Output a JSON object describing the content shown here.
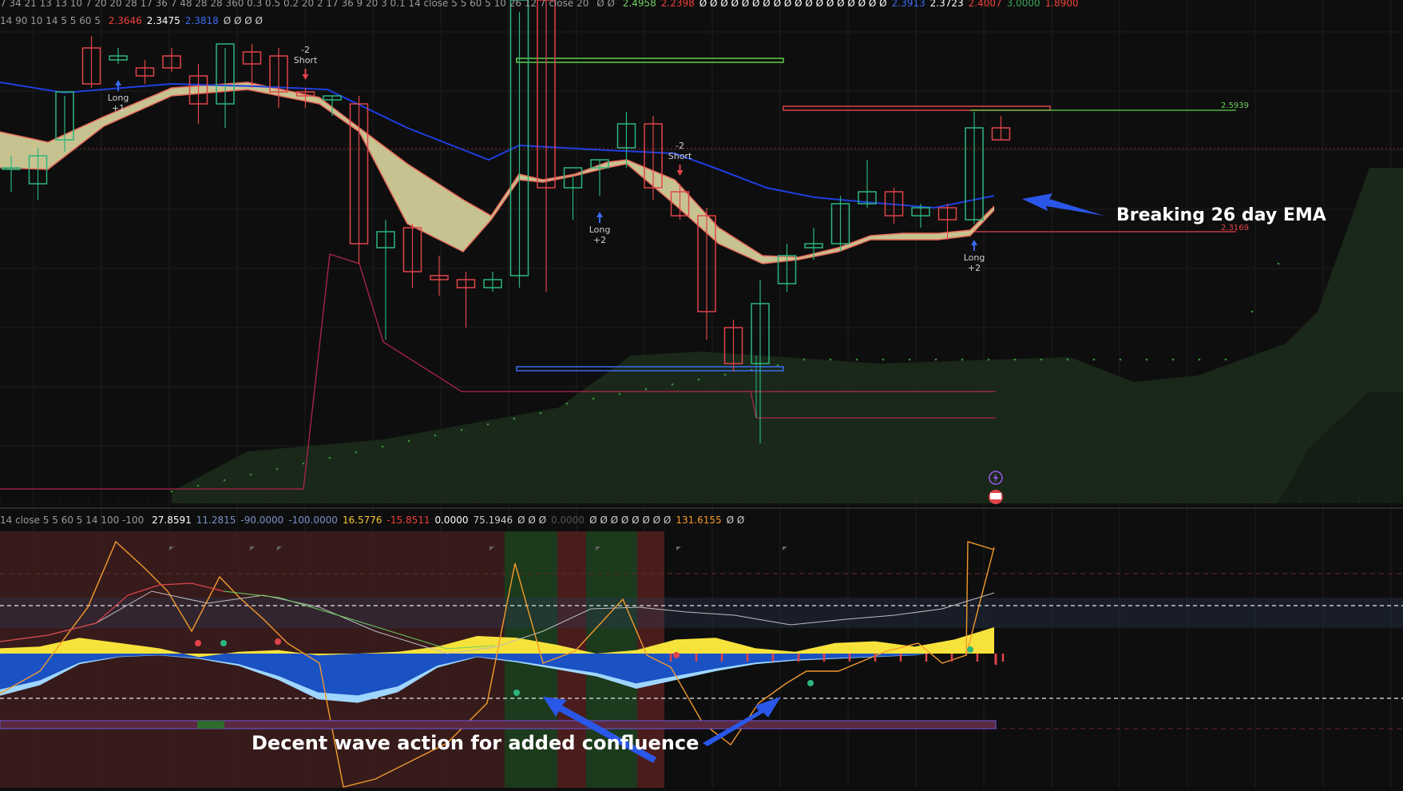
{
  "top_legend": {
    "row1": "7 34 21 13 13 10 7 20 20 28 17 36 7 48 28 28 360 0.3 0.5 0.2 20 2 17 36 9 20 3 0.1 14 close 5 5 60 5 10 26 12 7 close 20",
    "row1_symbols": "Ø Ø",
    "row1_values": [
      {
        "text": "2.4958",
        "color": "#6fcf63"
      },
      {
        "text": "2.2398",
        "color": "#f0413b"
      },
      {
        "text": "Ø Ø Ø Ø Ø Ø Ø Ø Ø Ø Ø Ø Ø Ø Ø Ø Ø Ø",
        "color": "#ffffff"
      },
      {
        "text": "2.3913",
        "color": "#3a6cf0"
      },
      {
        "text": "2.3723",
        "color": "#ffffff"
      },
      {
        "text": "2.4007",
        "color": "#f0413b"
      },
      {
        "text": "3.0000",
        "color": "#3aa55b"
      },
      {
        "text": "1.8900",
        "color": "#f0413b"
      }
    ],
    "row2_prefix": "14 90 10 14 5 5 60 5",
    "row2_values": [
      {
        "text": "2.3646",
        "color": "#f0413b"
      },
      {
        "text": "2.3475",
        "color": "#ffffff"
      },
      {
        "text": "2.3818",
        "color": "#3a6cf0"
      },
      {
        "text": "Ø Ø Ø Ø",
        "color": "#cfcfcf"
      }
    ]
  },
  "lower_legend": {
    "prefix": "14 close 5 5 60 5 14 100 -100",
    "values": [
      {
        "text": "27.8591",
        "color": "#ffffff"
      },
      {
        "text": "11.2815",
        "color": "#7a91c8"
      },
      {
        "text": "-90.0000",
        "color": "#7a91c8"
      },
      {
        "text": "-100.0000",
        "color": "#7a91c8"
      },
      {
        "text": "16.5776",
        "color": "#f6c531"
      },
      {
        "text": "-15.8511",
        "color": "#f0413b"
      },
      {
        "text": "0.0000",
        "color": "#ffffff"
      },
      {
        "text": "75.1946",
        "color": "#cfcfcf"
      },
      {
        "text": "Ø Ø Ø",
        "color": "#cfcfcf"
      },
      {
        "text": "0.0000",
        "color": "#555555"
      },
      {
        "text": "Ø Ø Ø Ø Ø Ø Ø Ø",
        "color": "#cfcfcf"
      },
      {
        "text": "131.6155",
        "color": "#f39a2c"
      },
      {
        "text": "Ø Ø",
        "color": "#cfcfcf"
      }
    ]
  },
  "annotations": {
    "breaking": "Breaking 26 day EMA",
    "wave": "Decent wave action for added confluence"
  },
  "colors": {
    "background": "#0e0e0e",
    "bull": "#2bb57d",
    "bear": "#e0444a",
    "ema": "#1f3fe0",
    "ribbon": "#e7e3a8",
    "cloud": "#1b2b1b",
    "wave_dark": "#1a52c4",
    "wave_light": "#9fd6ff",
    "money_flow": "#f7e23b",
    "arrow": "#2a57e8"
  },
  "chart_data": [
    {
      "type": "candlestick",
      "title": "",
      "price_range": [
        1.7,
        2.8
      ],
      "candles": [
        {
          "o": 2.46,
          "h": 2.49,
          "l": 2.4,
          "c": 2.46
        },
        {
          "o": 2.42,
          "h": 2.51,
          "l": 2.38,
          "c": 2.49
        },
        {
          "o": 2.53,
          "h": 2.64,
          "l": 2.5,
          "c": 2.65
        },
        {
          "o": 2.76,
          "h": 2.79,
          "l": 2.66,
          "c": 2.67
        },
        {
          "o": 2.73,
          "h": 2.76,
          "l": 2.72,
          "c": 2.74
        },
        {
          "o": 2.71,
          "h": 2.73,
          "l": 2.67,
          "c": 2.69
        },
        {
          "o": 2.74,
          "h": 2.76,
          "l": 2.7,
          "c": 2.71
        },
        {
          "o": 2.69,
          "h": 2.72,
          "l": 2.57,
          "c": 2.62
        },
        {
          "o": 2.62,
          "h": 2.76,
          "l": 2.56,
          "c": 2.77
        },
        {
          "o": 2.75,
          "h": 2.77,
          "l": 2.66,
          "c": 2.72
        },
        {
          "o": 2.74,
          "h": 2.76,
          "l": 2.61,
          "c": 2.65
        },
        {
          "o": 2.65,
          "h": 2.66,
          "l": 2.61,
          "c": 2.64
        },
        {
          "o": 2.63,
          "h": 2.64,
          "l": 2.59,
          "c": 2.64
        },
        {
          "o": 2.62,
          "h": 2.64,
          "l": 2.22,
          "c": 2.27
        },
        {
          "o": 2.26,
          "h": 2.33,
          "l": 2.03,
          "c": 2.3
        },
        {
          "o": 2.31,
          "h": 2.32,
          "l": 2.16,
          "c": 2.2
        },
        {
          "o": 2.19,
          "h": 2.24,
          "l": 2.14,
          "c": 2.18
        },
        {
          "o": 2.18,
          "h": 2.2,
          "l": 2.06,
          "c": 2.16
        },
        {
          "o": 2.16,
          "h": 2.2,
          "l": 2.15,
          "c": 2.18
        },
        {
          "o": 2.19,
          "h": 2.85,
          "l": 2.16,
          "c": 3.0
        },
        {
          "o": 2.98,
          "h": 3.0,
          "l": 2.15,
          "c": 2.41
        },
        {
          "o": 2.41,
          "h": 2.44,
          "l": 2.33,
          "c": 2.46
        },
        {
          "o": 2.46,
          "h": 2.48,
          "l": 2.39,
          "c": 2.48
        },
        {
          "o": 2.51,
          "h": 2.6,
          "l": 2.46,
          "c": 2.57
        },
        {
          "o": 2.57,
          "h": 2.59,
          "l": 2.38,
          "c": 2.41
        },
        {
          "o": 2.4,
          "h": 2.42,
          "l": 2.33,
          "c": 2.34
        },
        {
          "o": 2.34,
          "h": 2.36,
          "l": 2.03,
          "c": 2.1
        },
        {
          "o": 2.06,
          "h": 2.08,
          "l": 1.95,
          "c": 1.97
        },
        {
          "o": 1.97,
          "h": 2.18,
          "l": 1.77,
          "c": 2.12
        },
        {
          "o": 2.17,
          "h": 2.27,
          "l": 2.15,
          "c": 2.24
        },
        {
          "o": 2.26,
          "h": 2.31,
          "l": 2.23,
          "c": 2.27
        },
        {
          "o": 2.27,
          "h": 2.39,
          "l": 2.25,
          "c": 2.37
        },
        {
          "o": 2.37,
          "h": 2.48,
          "l": 2.36,
          "c": 2.4
        },
        {
          "o": 2.4,
          "h": 2.41,
          "l": 2.32,
          "c": 2.34
        },
        {
          "o": 2.34,
          "h": 2.37,
          "l": 2.31,
          "c": 2.36
        },
        {
          "o": 2.36,
          "h": 2.37,
          "l": 2.28,
          "c": 2.33
        },
        {
          "o": 2.33,
          "h": 2.6,
          "l": 2.32,
          "c": 2.56
        },
        {
          "o": 2.56,
          "h": 2.59,
          "l": 2.53,
          "c": 2.53
        }
      ],
      "price_labels": [
        "2.5939",
        "2.3169"
      ],
      "signals": [
        {
          "index": 4,
          "type": "Long",
          "value": "+1"
        },
        {
          "index": 11,
          "type": "Short",
          "value": "-2"
        },
        {
          "index": 22,
          "type": "Long",
          "value": "+2"
        },
        {
          "index": 25,
          "type": "Short",
          "value": "-2"
        },
        {
          "index": 36,
          "type": "Long",
          "value": "+2"
        }
      ]
    },
    {
      "type": "area",
      "title": "",
      "series": [
        {
          "values": [
            0.3,
            0.4,
            0.9,
            0.6,
            0.3,
            -0.2,
            0.1,
            0.2,
            -0.1,
            0.0,
            0.1,
            0.4,
            1.0,
            0.9,
            0.5,
            0.0,
            0.2,
            0.8,
            0.9,
            0.3,
            0.1,
            0.6,
            0.7,
            0.4,
            0.8,
            1.5
          ]
        },
        {
          "values": [
            -2.4,
            -1.8,
            -0.6,
            -0.2,
            -0.1,
            -0.3,
            -0.7,
            -1.5,
            -2.6,
            -2.8,
            -2.2,
            -0.8,
            -0.2,
            -0.5,
            -0.9,
            -1.3,
            -2.0,
            -1.5,
            -1.0,
            -0.6,
            -0.4,
            -0.3,
            -0.2,
            -0.1,
            0.2,
            0.8
          ]
        }
      ]
    }
  ]
}
